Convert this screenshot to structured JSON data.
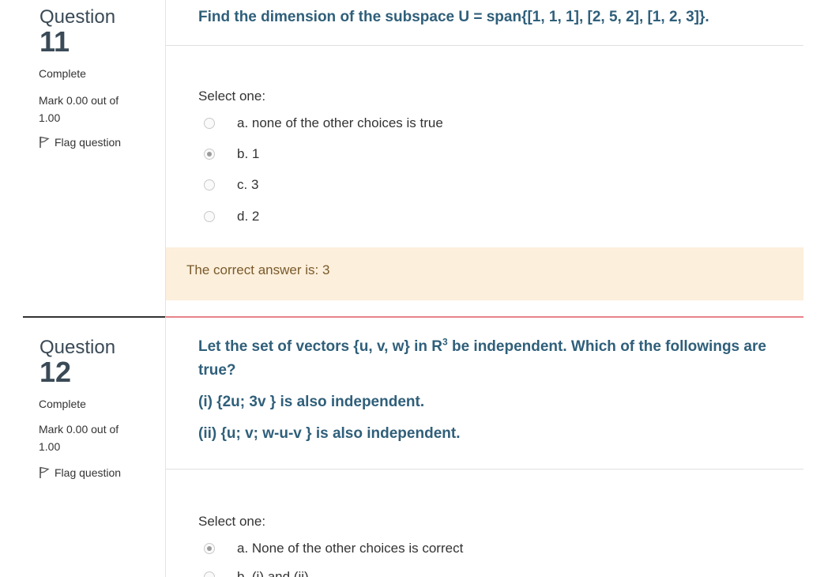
{
  "questions": [
    {
      "word": "Question",
      "number": "11",
      "state": "Complete",
      "grade": "Mark 0.00 out of 1.00",
      "flag_label": "Flag question",
      "text": "Find the dimension of the subspace U = span{[1, 1, 1], [2, 5, 2], [1, 2, 3]}.",
      "prompt": "Select one:",
      "options": [
        {
          "label": "a. none of the other choices is true",
          "checked": false
        },
        {
          "label": "b. 1",
          "checked": true
        },
        {
          "label": "c. 3",
          "checked": false
        },
        {
          "label": "d. 2",
          "checked": false
        }
      ],
      "feedback": "The correct answer is: 3"
    },
    {
      "word": "Question",
      "number": "12",
      "state": "Complete",
      "grade": "Mark 0.00 out of 1.00",
      "flag_label": "Flag question",
      "text_pre": "Let the set of vectors {u, v, w} in R",
      "text_sup": "3",
      "text_post": " be independent. Which of the followings are true?",
      "line1": "(i) {2u; 3v } is also independent.",
      "line2": "(ii) {u; v; w-u-v } is also independent.",
      "prompt": "Select one:",
      "options": [
        {
          "label": "a. None of the other choices is correct",
          "checked": true
        },
        {
          "label": "b. (i) and (ii)",
          "checked": false
        }
      ]
    }
  ],
  "colors": {
    "question_text": "#2f5f7a",
    "feedback_bg": "#fcefdc",
    "active_separator": "#e8838a"
  },
  "icons": {
    "flag": "flag-icon"
  }
}
